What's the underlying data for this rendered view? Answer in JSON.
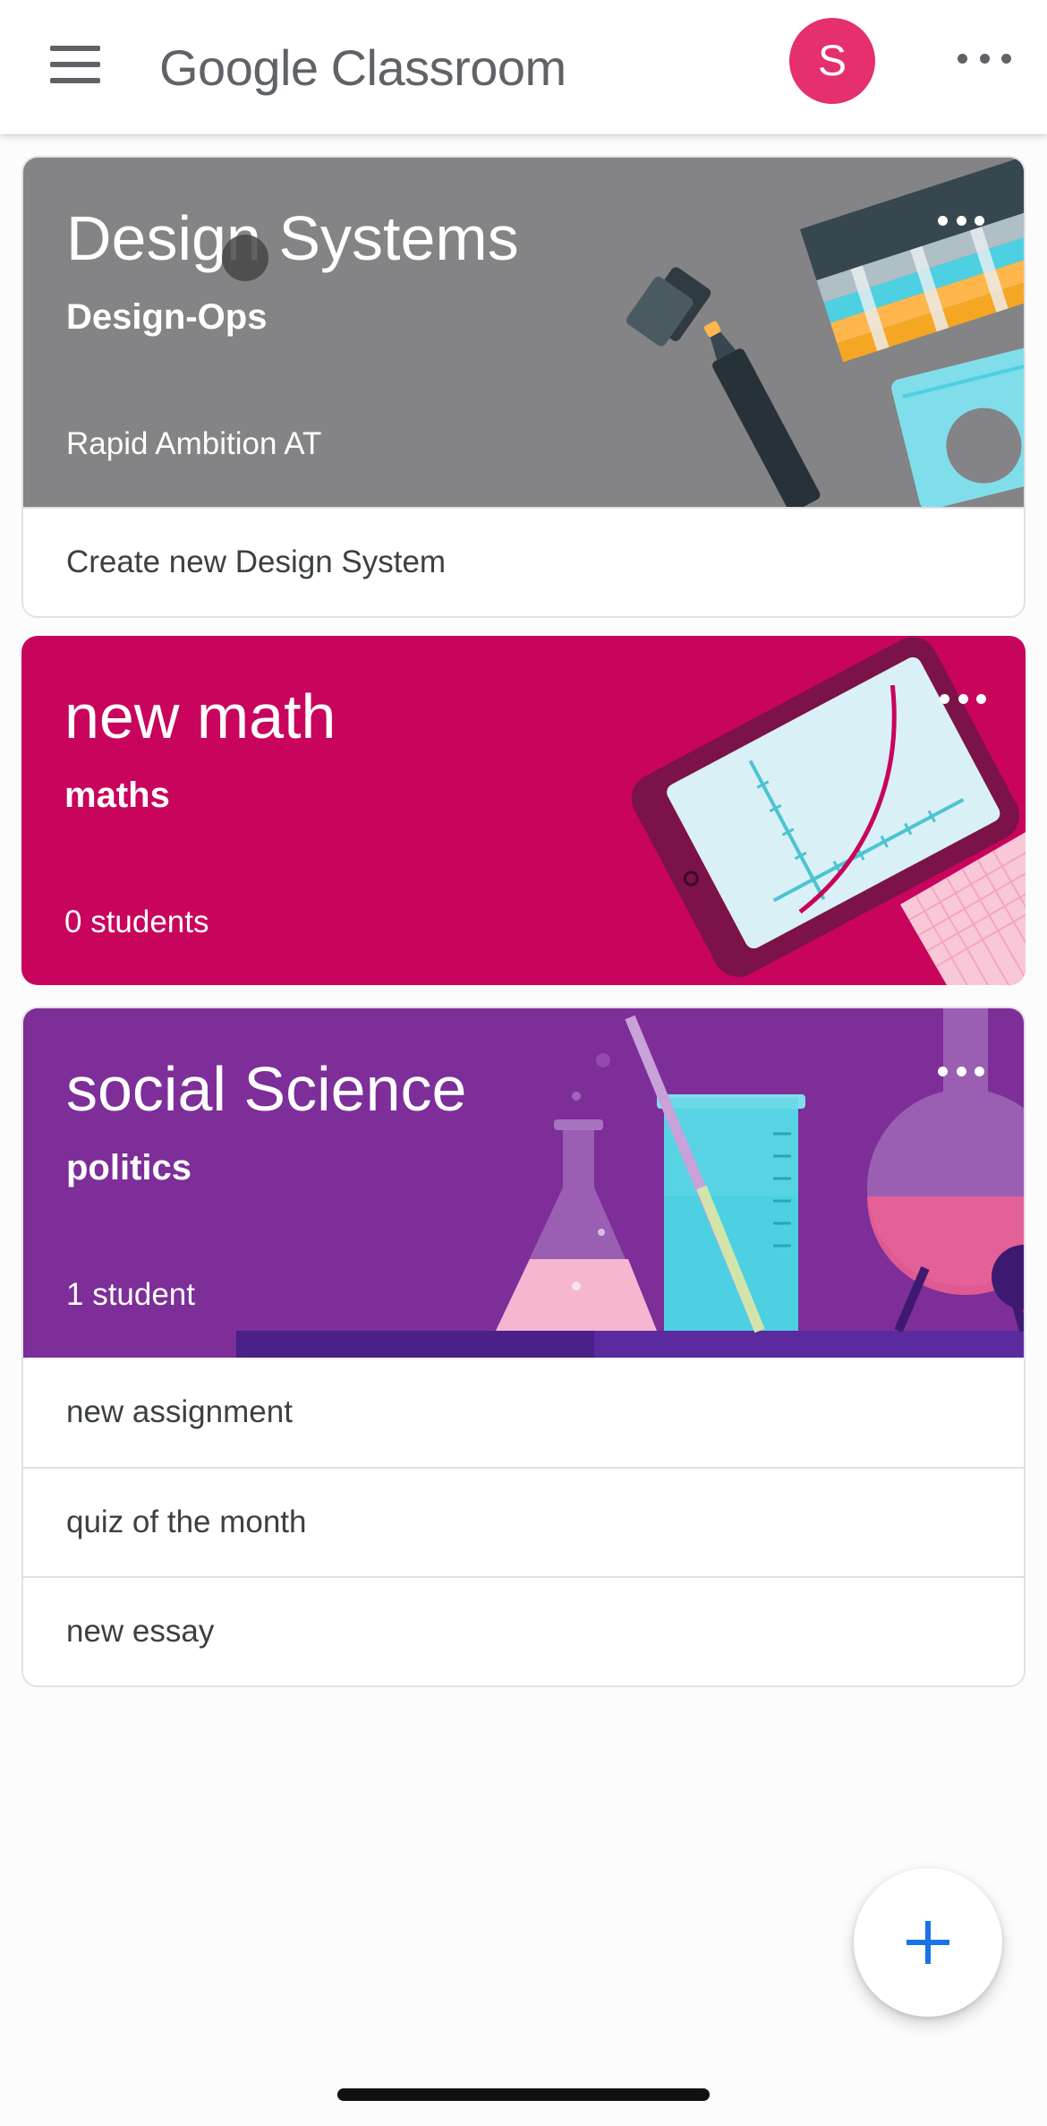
{
  "app": {
    "brand_google": "Google",
    "brand_product": "Classroom",
    "avatar_letter": "S"
  },
  "colors": {
    "design_card": "#848385",
    "math_card": "#c8045c",
    "science_card": "#7d2e98",
    "avatar": "#e52f6f",
    "fab_plus": "#1a73e8"
  },
  "classes": [
    {
      "title": "Design Systems",
      "section": "Design-Ops",
      "meta": "Rapid Ambition AT",
      "items": [
        "Create new Design System"
      ]
    },
    {
      "title": "new math",
      "section": "maths",
      "meta": "0 students",
      "items": []
    },
    {
      "title": "social Science",
      "section": "politics",
      "meta": "1 student",
      "items": [
        "new assignment",
        "quiz of the month",
        "new essay"
      ]
    }
  ],
  "icons": {
    "menu": "menu-icon",
    "more": "more-horizontal-icon",
    "add": "plus-icon"
  }
}
